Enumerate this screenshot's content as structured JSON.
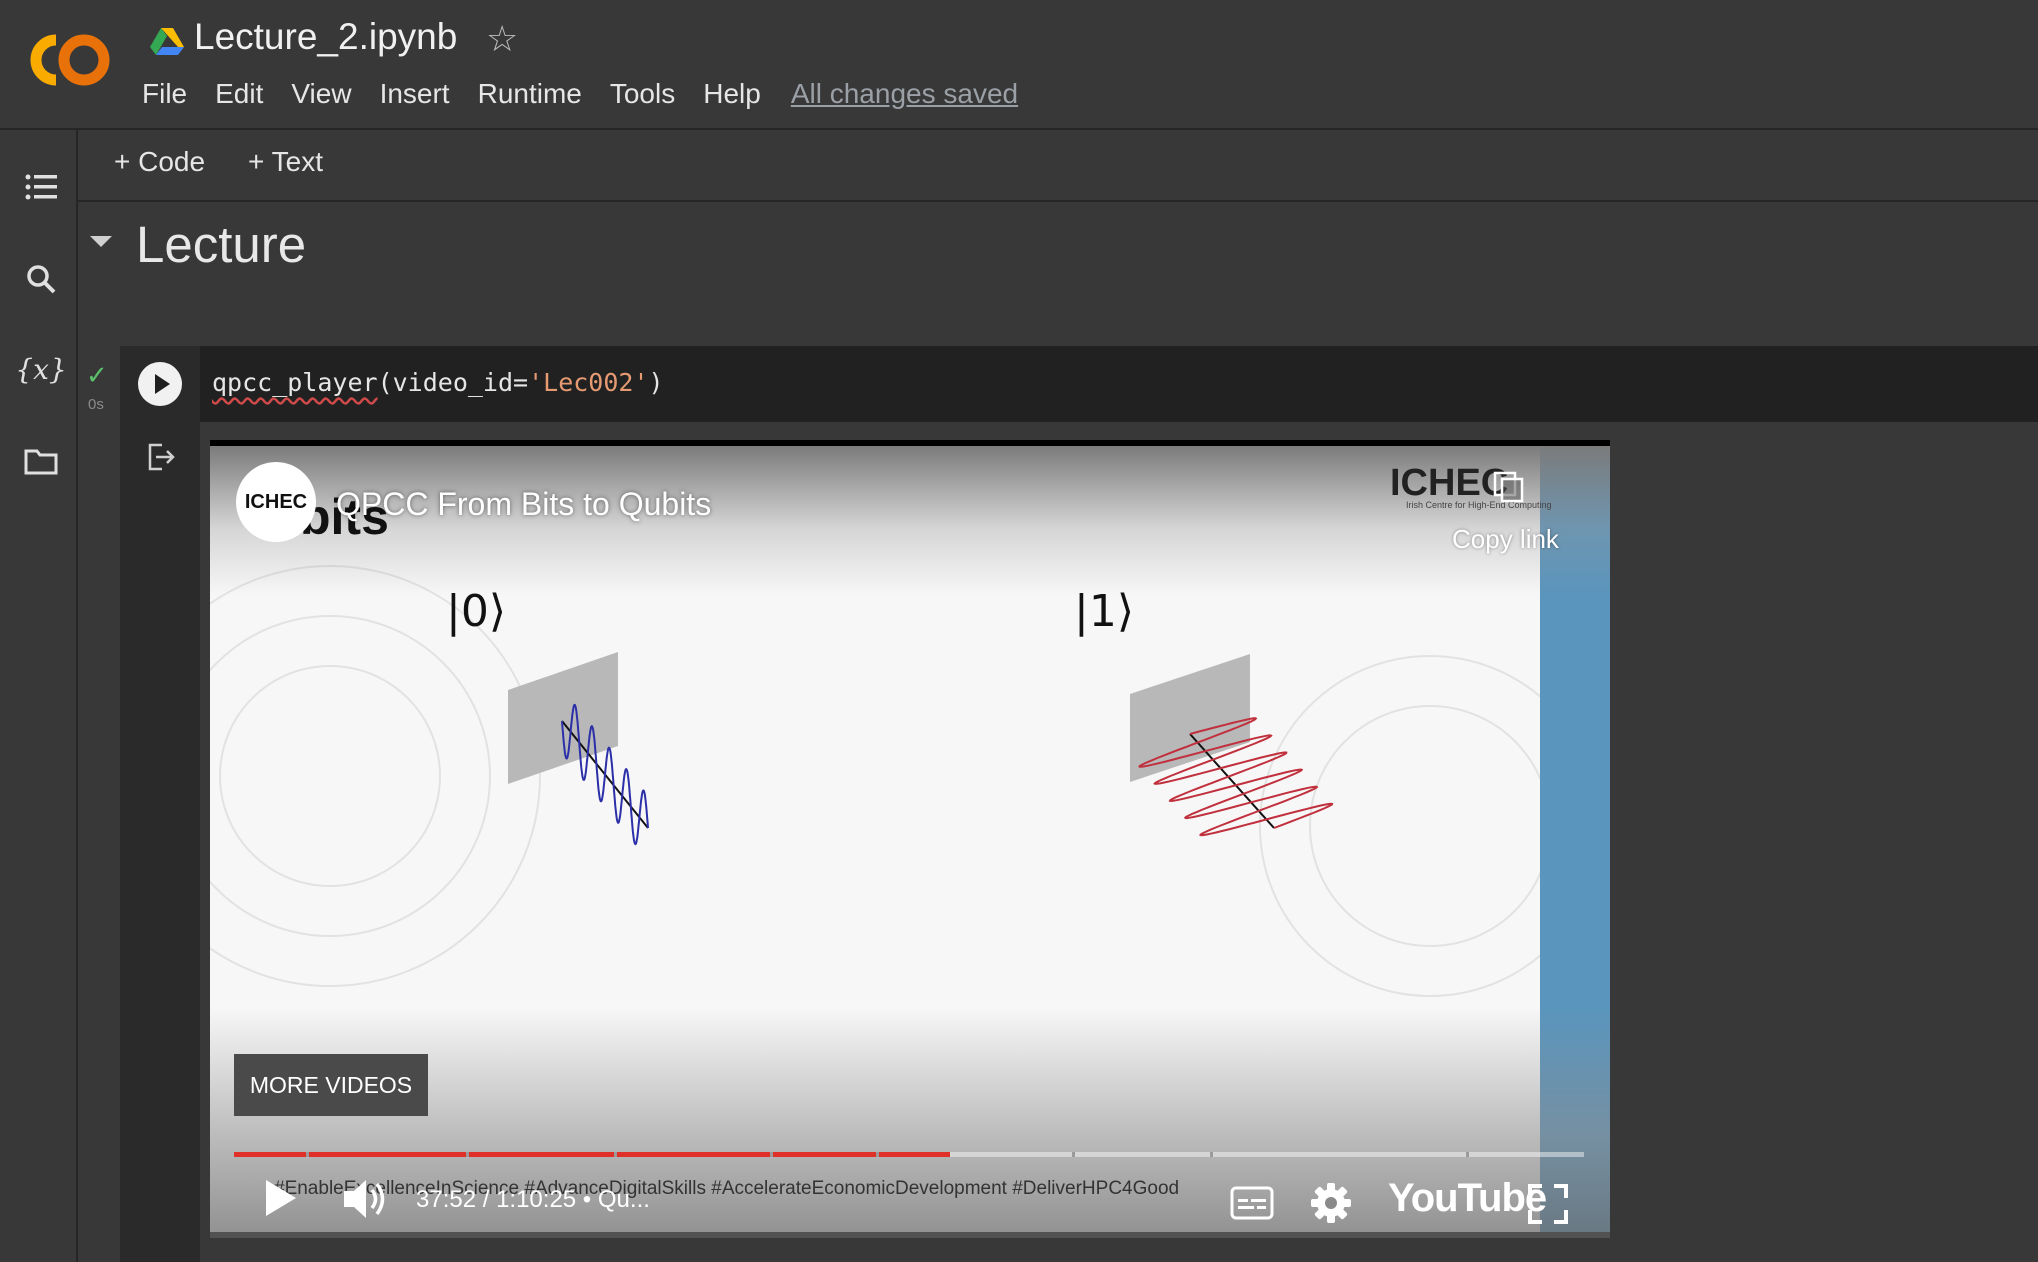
{
  "header": {
    "title": "Lecture_2.ipynb",
    "menu": [
      "File",
      "Edit",
      "View",
      "Insert",
      "Runtime",
      "Tools",
      "Help"
    ],
    "save_status": "All changes saved"
  },
  "toolbar": {
    "add_code": "+ Code",
    "add_text": "+ Text"
  },
  "sidebar": {
    "icons": [
      "table-of-contents-icon",
      "search-icon",
      "variables-icon",
      "files-icon"
    ],
    "variables_glyph": "{x}"
  },
  "section": {
    "title": "Lecture"
  },
  "cell": {
    "exec_time": "0s",
    "code_fn": "qpcc_player",
    "code_open": "(video_id=",
    "code_str": "'Lec002'",
    "code_close": ")"
  },
  "video": {
    "channel": "ICHEC",
    "slide_heading": "bits",
    "title": "QPCC From Bits to Qubits",
    "brand": "ICHEC",
    "brand_sub": "Irish Centre for High-End Computing",
    "copy_link": "Copy link",
    "ket0": "|0⟩",
    "ket1": "|1⟩",
    "more_videos": "MORE VIDEOS",
    "hashtags": "#EnableExcellenceInScience #AdvanceDigitalSkills #AccelerateEconomicDevelopment #DeliverHPC4Good",
    "time": "37:52 / 1:10:25",
    "chapter": "Qu...",
    "progress": 0.53,
    "youtube": "YouTube",
    "colors": {
      "progress": "#e0302a",
      "blue_strip": "#5a95bd",
      "wave0": "#2b2fa8",
      "wave1": "#c0303d"
    }
  }
}
